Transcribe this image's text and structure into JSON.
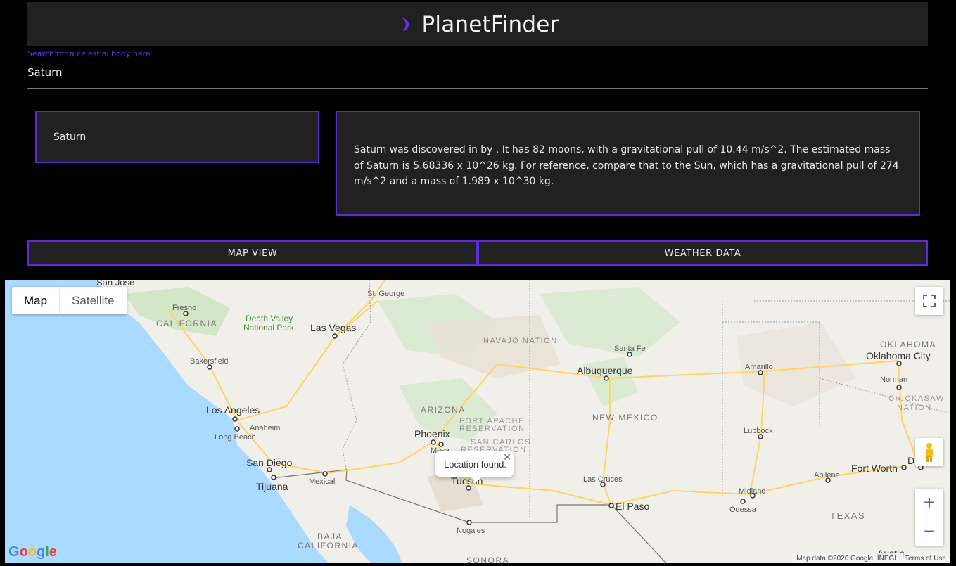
{
  "app": {
    "title": "PlanetFinder",
    "accent": "#6a2cf0"
  },
  "search": {
    "label": "Search for a celestial body here",
    "value": "Saturn"
  },
  "planet": {
    "name": "Saturn",
    "description": "Saturn was discovered in by . It has 82 moons, with a gravitational pull of 10.44 m/s^2. The estimated mass of Saturn is 5.68336 x 10^26 kg. For reference, compare that to the Sun, which has a gravitational pull of 274 m/s^2 and a mass of 1.989 x 10^30 kg."
  },
  "tabs": {
    "map": "MAP VIEW",
    "weather": "WEATHER DATA"
  },
  "map": {
    "types": [
      "Map",
      "Satellite"
    ],
    "selected_type": "Map",
    "infowindow": "Location found.",
    "attribution": "Map data ©2020 Google, INEGI",
    "terms": "Terms of Use",
    "logo": "Google",
    "zoom_in": "+",
    "zoom_out": "−",
    "labels": {
      "san_jose": "San Jose",
      "st_george": "St. George",
      "fresno": "Fresno",
      "california": "CALIFORNIA",
      "death_valley_1": "Death Valley",
      "death_valley_2": "National Park",
      "las_vegas": "Las Vegas",
      "navajo": "NAVAJO NATION",
      "santa_fe": "Santa Fe",
      "oklahoma": "OKLAHOMA",
      "oklahoma_city": "Oklahoma City",
      "bakersfield": "Bakersfield",
      "albuquerque": "Albuquerque",
      "amarillo": "Amarillo",
      "norman": "Norman",
      "chickasaw_1": "CHICKASAW",
      "chickasaw_2": "NATION",
      "arizona": "ARIZONA",
      "fort_apache_1": "FORT APACHE",
      "fort_apache_2": "RESERVATION",
      "los_angeles": "Los Angeles",
      "anaheim": "Anaheim",
      "long_beach": "Long Beach",
      "new_mexico": "NEW MEXICO",
      "phoenix": "Phoenix",
      "mesa": "Mesa",
      "san_carlos_1": "SAN CARLOS",
      "san_carlos_2": "RESERVATION",
      "lubbock": "Lubbock",
      "san_diego": "San Diego",
      "tijuana": "Tijuana",
      "mexicali": "Mexicali",
      "tucson": "Tucson",
      "las_cruces": "Las Cruces",
      "fort_worth": "Fort Worth",
      "abilene": "Abilene",
      "midland": "Midland",
      "odessa": "Odessa",
      "el_paso": "El Paso",
      "texas": "TEXAS",
      "nogales": "Nogales",
      "baja_1": "BAJA",
      "baja_2": "CALIFORNIA",
      "sonora": "SONORA",
      "austin": "Austin",
      "dallas_d": "D"
    }
  }
}
